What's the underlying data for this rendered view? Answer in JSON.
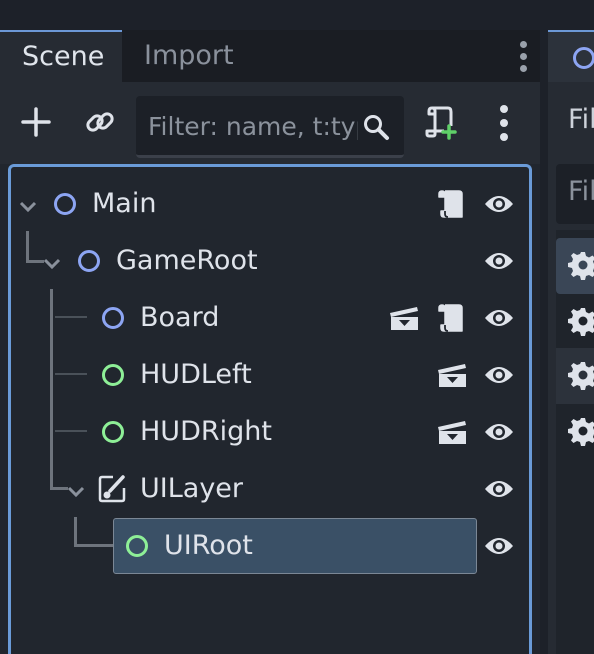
{
  "tabs": {
    "scene": "Scene",
    "import": "Import"
  },
  "toolbar": {
    "filter_placeholder": "Filter: name, t:type, g:group",
    "add_icon": "plus-icon",
    "link_icon": "link-icon",
    "script_icon": "add-script-icon",
    "menu_icon": "kebab-menu-icon"
  },
  "tree": {
    "nodes": [
      {
        "label": "Main",
        "icon": "node2d-circle-icon"
      },
      {
        "label": "GameRoot",
        "icon": "node2d-circle-icon"
      },
      {
        "label": "Board",
        "icon": "node2d-circle-icon"
      },
      {
        "label": "HUDLeft",
        "icon": "control-circle-icon"
      },
      {
        "label": "HUDRight",
        "icon": "control-circle-icon"
      },
      {
        "label": "UILayer",
        "icon": "canvas-layer-icon"
      },
      {
        "label": "UIRoot",
        "icon": "control-circle-icon"
      }
    ],
    "selected": "UIRoot"
  },
  "right_dock": {
    "tab_fragment": "",
    "toolbar_fragment": "Fil",
    "filter_fragment": "Fil"
  },
  "colors": {
    "accent": "#6a9bd8",
    "node2d": "#8da5f3",
    "control": "#8eef97",
    "selected_bg": "#3a5066"
  }
}
